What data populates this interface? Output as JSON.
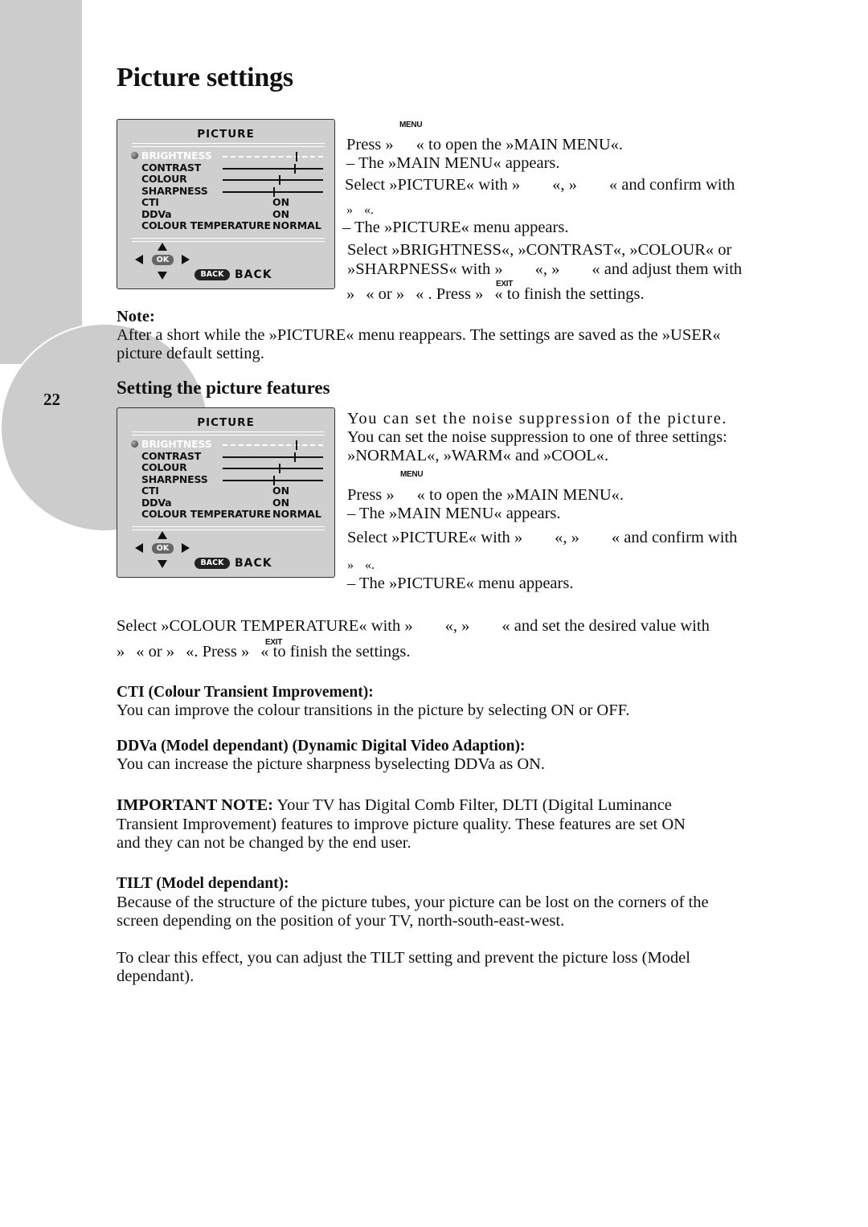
{
  "page": {
    "number": "22",
    "title": "Picture settings",
    "section_title": "Setting the picture features"
  },
  "osd_menu": {
    "title": "PICTURE",
    "items": [
      {
        "label": "BRIGHTNESS",
        "type": "slider",
        "value": 0.73,
        "selected": true
      },
      {
        "label": "CONTRAST",
        "type": "slider",
        "value": 0.71,
        "selected": false
      },
      {
        "label": "COLOUR",
        "type": "slider",
        "value": 0.56,
        "selected": false
      },
      {
        "label": "SHARPNESS",
        "type": "slider",
        "value": 0.5,
        "selected": false
      },
      {
        "label": "CTI",
        "type": "value",
        "value": "ON"
      },
      {
        "label": "DDVa",
        "type": "value",
        "value": "ON"
      },
      {
        "label": "COLOUR TEMPERATURE",
        "type": "value",
        "value": "NORMAL"
      }
    ],
    "nav": {
      "ok_label": "OK",
      "back_button": "BACK",
      "back_label": "BACK"
    }
  },
  "section1": {
    "menu_key": "MENU",
    "exit_key": "EXIT",
    "line1": [
      "Press »",
      "« to open the »MAIN MENU«."
    ],
    "line2": "– The »MAIN MENU« appears.",
    "line3": [
      "Select »PICTURE« with »",
      "«, »",
      "« and confirm with"
    ],
    "line4": [
      "»",
      "«."
    ],
    "line5": "– The »PICTURE« menu appears.",
    "line6": "Select »BRIGHTNESS«, »CONTRAST«, »COLOUR« or",
    "line7": [
      "»SHARPNESS« with »",
      "«, »",
      "« and adjust them with"
    ],
    "line8": [
      "»",
      "« or »",
      "« . Press »",
      "« to finish the settings."
    ]
  },
  "note": {
    "heading": "Note:",
    "line1": "After a short while the »PICTURE« menu reappears. The settings are saved as the »USER«",
    "line2": "picture default setting."
  },
  "section2": {
    "menu_key": "MENU",
    "exit_key": "EXIT",
    "intro1": "You can set the noise suppression of the picture.",
    "intro2": "You can set the noise suppression to one of three settings:",
    "intro3": "»NORMAL«, »WARM« and »COOL«.",
    "line1": [
      "Press »",
      "« to open the »MAIN MENU«."
    ],
    "line2": "– The »MAIN MENU« appears.",
    "line3": [
      "Select »PICTURE« with »",
      "«, »",
      "« and confirm with"
    ],
    "line4": [
      "»",
      "«."
    ],
    "line5": "– The »PICTURE« menu appears.",
    "line6": [
      "Select »COLOUR TEMPERATURE« with »",
      "«, »",
      "« and set the desired value with"
    ],
    "line7": [
      "»",
      "« or »",
      "«. Press »",
      "« to finish the settings."
    ]
  },
  "cti": {
    "heading": "CTI (Colour Transient Improvement):",
    "text": "You can improve the colour transitions in the picture by selecting ON or OFF."
  },
  "ddva": {
    "heading": "DDVa (Model dependant) (Dynamic Digital Video Adaption):",
    "text": "You can increase the picture sharpness byselecting DDVa as ON."
  },
  "important": {
    "label": "IMPORTANT NOTE:",
    "line1": " Your TV has Digital Comb Filter, DLTI (Digital Luminance",
    "line2": "Transient Improvement) features  to improve picture quality. These features are set ON",
    "line3": "and they can not be changed by the end user."
  },
  "tilt": {
    "heading": "TILT (Model dependant):",
    "line1": "Because of the structure of the picture tubes, your picture can be lost on the corners of the",
    "line2": "screen depending on the position of your TV, north-south-east-west.",
    "line3": "To clear this effect, you can adjust the TILT setting and prevent the picture loss  (Model",
    "line4": "dependant)."
  }
}
